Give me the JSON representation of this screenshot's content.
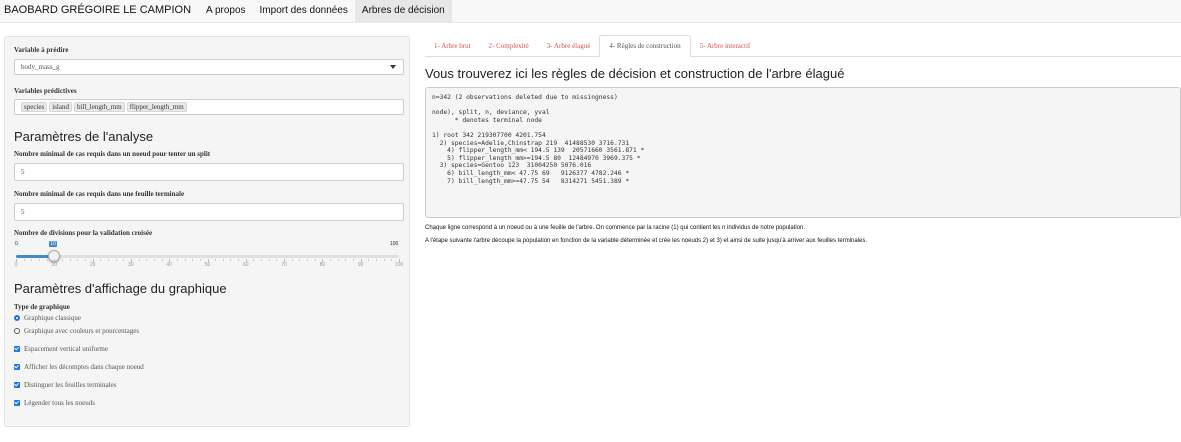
{
  "navbar": {
    "brand": "BAOBARD GRÉGOIRE LE CAMPION",
    "items": [
      "A propos",
      "Import des données",
      "Arbres de décision"
    ],
    "active": "Arbres de décision"
  },
  "sidebar": {
    "target_label": "Variable à prédire",
    "target_value": "body_mass_g",
    "predictors_label": "Variables prédictives",
    "predictors": [
      "species",
      "island",
      "bill_length_mm",
      "flipper_length_mm"
    ],
    "analysis_title": "Paramètres de l'analyse",
    "min_split_label": "Nombre minimal de cas requis dans un noeud pour tenter un split",
    "min_split_value": "5",
    "min_bucket_label": "Nombre minimal de cas requis dans une feuille terminale",
    "min_bucket_value": "5",
    "xval_label": "Nombre de divisions pour la validation croisée",
    "slider": {
      "min": 0,
      "max": 100,
      "value": 10,
      "min_label": "0",
      "max_label": "100",
      "value_label": "10",
      "ticks": [
        "0",
        "10",
        "20",
        "30",
        "40",
        "50",
        "60",
        "70",
        "80",
        "90",
        "100"
      ]
    },
    "display_title": "Paramètres d'affichage du graphique",
    "graph_type_label": "Type de graphique",
    "radio_options": [
      {
        "label": "Graphique classique",
        "checked": true
      },
      {
        "label": "Graphique avec couleurs et pourcentages",
        "checked": false
      }
    ],
    "checkboxes": [
      {
        "label": "Espacement vertical uniforme",
        "checked": true
      },
      {
        "label": "Afficher les décomptes dans chaque noeud",
        "checked": true
      },
      {
        "label": "Distinguer les feuilles terminales",
        "checked": true
      },
      {
        "label": "Légender tous les noeuds",
        "checked": true
      }
    ]
  },
  "main": {
    "tabs": [
      {
        "label": "1- Arbre brut",
        "active": false
      },
      {
        "label": "2- Complexité",
        "active": false
      },
      {
        "label": "3- Arbre élagué",
        "active": false
      },
      {
        "label": "4- Règles de construction",
        "active": true
      },
      {
        "label": "5- Arbre interactif",
        "active": false
      }
    ],
    "title": "Vous trouverez ici les règles de décision et construction de l'arbre élagué",
    "code_lines": [
      "n=342 (2 observations deleted due to missingness)",
      "",
      "node), split, n, deviance, yval",
      "      * denotes terminal node",
      "",
      "1) root 342 219307700 4201.754",
      "  2) species=Adelie,Chinstrap 219  41488530 3716.731",
      "    4) flipper_length_mm< 194.5 139  20571660 3561.871 *",
      "    5) flipper_length_mm>=194.5 80  12484970 3969.375 *",
      "  3) species=Gentoo 123  31004250 5076.016",
      "    6) bill_length_mm< 47.75 69   9126377 4782.246 *",
      "    7) bill_length_mm>=47.75 54   8314271 5451.389 *"
    ],
    "note1": "Chaque ligne correspond à un noeud ou à une feuille de l'arbre. On commence par la racine (1) qui contient les n individus de notre population.",
    "note2": "A l'étape suivante l'arbre découpe la population en fonction de la variable déterminée et crée les noeuds 2) et 3) et ainsi de suite jusqu'à arriver aux feuilles terminales."
  },
  "colors": {
    "accent": "#428bca",
    "tab_link": "#d9534f",
    "checkbox": "#1a73e8"
  }
}
